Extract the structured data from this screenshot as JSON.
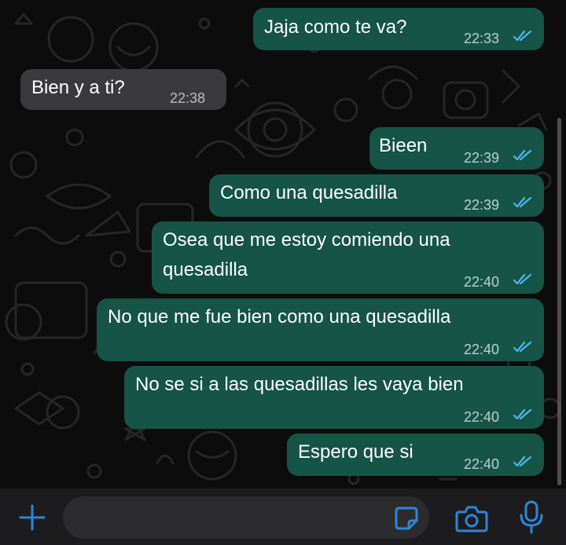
{
  "colors": {
    "outgoing_bubble": "#155447",
    "incoming_bubble": "#3a3a3c",
    "read_ticks": "#4fb6ec",
    "accent": "#2f86d8"
  },
  "messages": [
    {
      "direction": "outgoing",
      "text": "Jaja como te va?",
      "time": "22:33",
      "status": "read"
    },
    {
      "direction": "incoming",
      "text": "Bien y a ti?",
      "time": "22:38"
    },
    {
      "direction": "outgoing",
      "text": "Bieen",
      "time": "22:39",
      "status": "read"
    },
    {
      "direction": "outgoing",
      "text": "Como una quesadilla",
      "time": "22:39",
      "status": "read"
    },
    {
      "direction": "outgoing",
      "text_line1": "Osea que me estoy comiendo una",
      "text_line2": "quesadilla",
      "time": "22:40",
      "status": "read"
    },
    {
      "direction": "outgoing",
      "text": "No que me fue bien como una quesadilla",
      "time": "22:40",
      "status": "read"
    },
    {
      "direction": "outgoing",
      "text": "No se si a las quesadillas les vaya bien",
      "time": "22:40",
      "status": "read"
    },
    {
      "direction": "outgoing",
      "text": "Espero que si",
      "time": "22:40",
      "status": "read"
    }
  ],
  "composer": {
    "message_input_value": "",
    "icons": [
      "plus-icon",
      "sticker-icon",
      "camera-icon",
      "microphone-icon"
    ]
  }
}
